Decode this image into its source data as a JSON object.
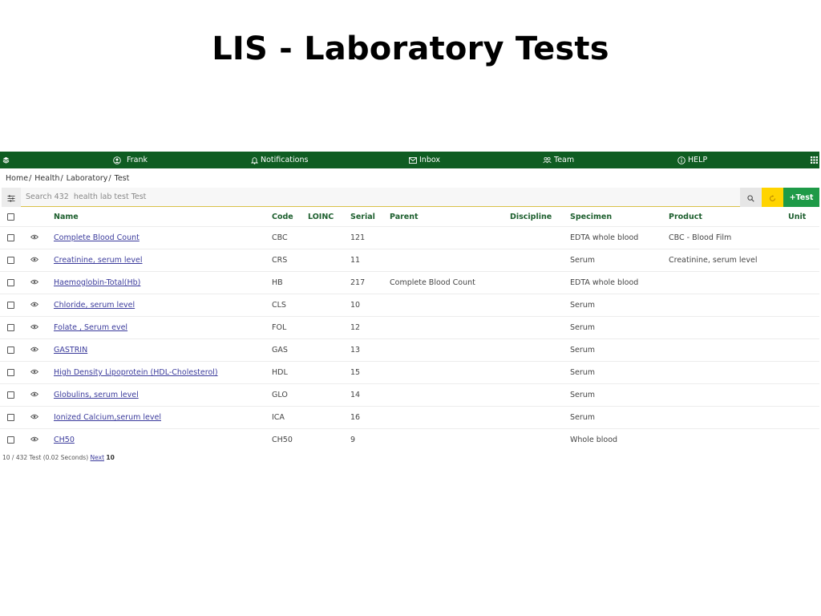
{
  "page_title": "LIS - Laboratory Tests",
  "nav": {
    "user": "Frank",
    "notifications": "Notifications",
    "inbox": "Inbox",
    "team": "Team",
    "help": "HELP"
  },
  "breadcrumb": [
    "Home",
    "Health",
    "Laboratory",
    "Test"
  ],
  "search": {
    "placeholder": "Search 432  health lab test Test",
    "value": "",
    "add_label": "+Test"
  },
  "table": {
    "columns": {
      "name": "Name",
      "code": "Code",
      "loinc": "LOINC",
      "serial": "Serial",
      "parent": "Parent",
      "discipline": "Discipline",
      "specimen": "Specimen",
      "product": "Product",
      "unit": "Unit"
    },
    "rows": [
      {
        "name": "Complete Blood Count",
        "code": "CBC",
        "loinc": "",
        "serial": "121",
        "parent": "",
        "discipline": "",
        "specimen": "EDTA whole blood",
        "product": "CBC - Blood Film",
        "unit": ""
      },
      {
        "name": "Creatinine, serum level",
        "code": "CRS",
        "loinc": "",
        "serial": "11",
        "parent": "",
        "discipline": "",
        "specimen": "Serum",
        "product": "Creatinine, serum level",
        "unit": ""
      },
      {
        "name": "Haemoglobin-Total(Hb)",
        "code": "HB",
        "loinc": "",
        "serial": "217",
        "parent": "Complete Blood Count",
        "discipline": "",
        "specimen": "EDTA whole blood",
        "product": "",
        "unit": ""
      },
      {
        "name": "Chloride, serum level",
        "code": "CLS",
        "loinc": "",
        "serial": "10",
        "parent": "",
        "discipline": "",
        "specimen": "Serum",
        "product": "",
        "unit": ""
      },
      {
        "name": "Folate , Serum evel",
        "code": "FOL",
        "loinc": "",
        "serial": "12",
        "parent": "",
        "discipline": "",
        "specimen": "Serum",
        "product": "",
        "unit": ""
      },
      {
        "name": "GASTRIN",
        "code": "GAS",
        "loinc": "",
        "serial": "13",
        "parent": "",
        "discipline": "",
        "specimen": "Serum",
        "product": "",
        "unit": ""
      },
      {
        "name": "High Density Lipoprotein (HDL-Cholesterol)",
        "code": "HDL",
        "loinc": "",
        "serial": "15",
        "parent": "",
        "discipline": "",
        "specimen": "Serum",
        "product": "",
        "unit": ""
      },
      {
        "name": "Globulins, serum level",
        "code": "GLO",
        "loinc": "",
        "serial": "14",
        "parent": "",
        "discipline": "",
        "specimen": "Serum",
        "product": "",
        "unit": ""
      },
      {
        "name": "Ionized Calcium,serum level",
        "code": "ICA",
        "loinc": "",
        "serial": "16",
        "parent": "",
        "discipline": "",
        "specimen": "Serum",
        "product": "",
        "unit": ""
      },
      {
        "name": "CH50",
        "code": "CH50",
        "loinc": "",
        "serial": "9",
        "parent": "",
        "discipline": "",
        "specimen": "Whole blood",
        "product": "",
        "unit": ""
      }
    ]
  },
  "footer": {
    "summary": "10 / 432 Test (0.02 Seconds)",
    "next_label": "Next",
    "next_count": "10"
  },
  "colors": {
    "nav_bg": "#0f5d22",
    "header_text": "#1d5f2e",
    "link": "#3b3b9c",
    "refresh_button": "#ffd400",
    "add_button": "#1e9a47"
  }
}
